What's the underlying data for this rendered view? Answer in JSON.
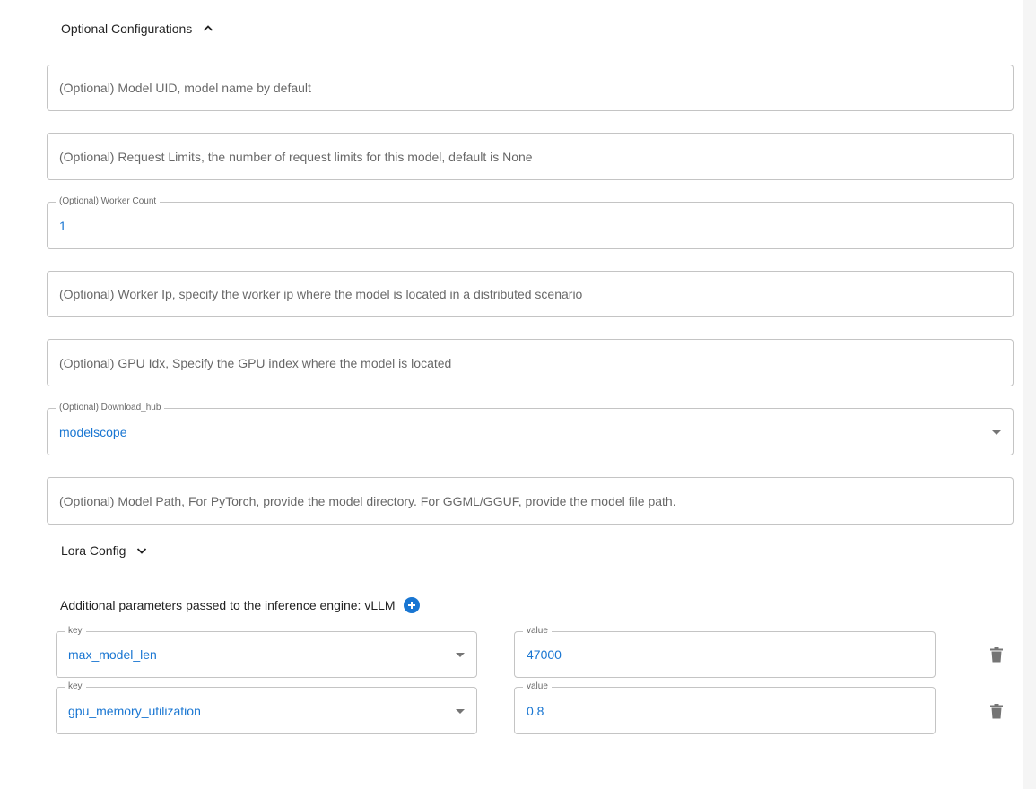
{
  "optional_configurations": {
    "label": "Optional Configurations",
    "expanded": true,
    "icon": "chevron-up-icon"
  },
  "fields": {
    "model_uid": {
      "placeholder": "(Optional) Model UID, model name by default"
    },
    "request_limits": {
      "placeholder": "(Optional) Request Limits, the number of request limits for this model, default is None"
    },
    "worker_count": {
      "label": "(Optional) Worker Count",
      "value": "1"
    },
    "worker_ip": {
      "placeholder": "(Optional) Worker Ip, specify the worker ip where the model is located in a distributed scenario"
    },
    "gpu_idx": {
      "placeholder": "(Optional) GPU Idx, Specify the GPU index where the model is located"
    },
    "download_hub": {
      "label": "(Optional) Download_hub",
      "value": "modelscope",
      "icon": "dropdown-caret-icon"
    },
    "model_path": {
      "placeholder": "(Optional) Model Path, For PyTorch, provide the model directory. For GGML/GGUF, provide the model file path."
    }
  },
  "lora_config": {
    "label": "Lora Config",
    "expanded": false,
    "icon": "chevron-down-icon"
  },
  "additional_params": {
    "label": "Additional parameters passed to the inference engine: vLLM",
    "add_icon": "plus-circle-icon",
    "delete_icon": "trash-icon",
    "rows": [
      {
        "key_label": "key",
        "key": "max_model_len",
        "value_label": "value",
        "value": "47000"
      },
      {
        "key_label": "key",
        "key": "gpu_memory_utilization",
        "value_label": "value",
        "value": "0.8"
      }
    ]
  },
  "colors": {
    "accent": "#1976d2",
    "border": "#c4c4c4",
    "placeholder": "#666666",
    "icon": "#757575"
  }
}
